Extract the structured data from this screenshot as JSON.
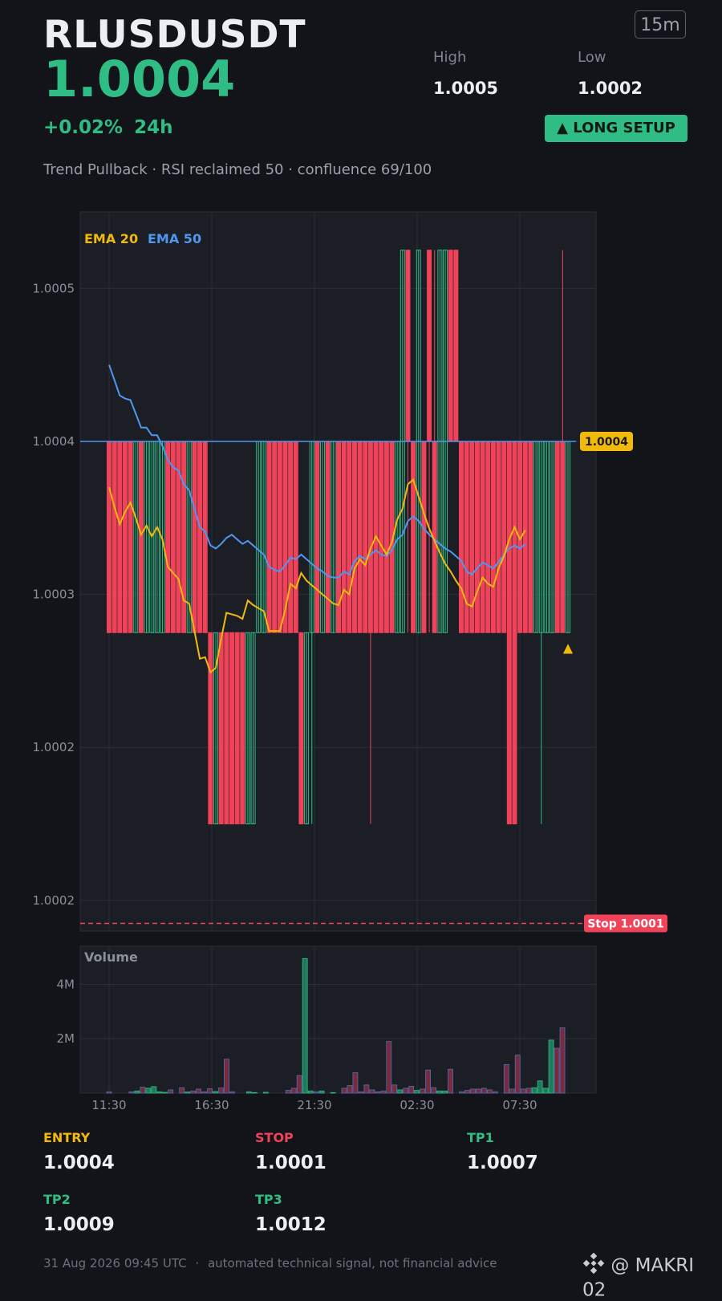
{
  "header": {
    "symbol": "RLUSDUSDT",
    "price": "1.0004",
    "change": "+0.02%",
    "period": "24h",
    "timeframe": "15m",
    "high_label": "High",
    "high_value": "1.0005",
    "low_label": "Low",
    "low_value": "1.0002",
    "setup_badge": "▲ LONG SETUP",
    "tagline": "Trend Pullback · RSI reclaimed 50 · confluence 69/100"
  },
  "colors": {
    "up": "#2fbd85",
    "down": "#f0435a",
    "ema20": "#f2b90d",
    "ema50": "#4f97f0",
    "background": "#131419",
    "panel": "#1c1e25"
  },
  "chart_data": {
    "type": "candlestick",
    "legend": [
      "EMA 20",
      "EMA 50"
    ],
    "price_ticks": [
      "1.0005",
      "1.0004",
      "1.0003",
      "1.0002",
      "1.0002"
    ],
    "ylim": [
      1.00008,
      1.00055
    ],
    "x_ticks": [
      "11:30",
      "16:30",
      "21:30",
      "02:30",
      "07:30"
    ],
    "current_price_label": "1.0004",
    "stop_line_label": "Stop 1.0001",
    "stop_price": 1.000085,
    "volume_title": "Volume",
    "volume_ticks": [
      "4M",
      "2M"
    ],
    "candles": [
      [
        1.0004,
        1.0004,
        1.000275,
        1.000275
      ],
      [
        1.0004,
        1.0004,
        1.000275,
        1.000275
      ],
      [
        1.0004,
        1.0004,
        1.000275,
        1.000275
      ],
      [
        1.0004,
        1.0004,
        1.000275,
        1.000275
      ],
      [
        1.0004,
        1.0004,
        1.000275,
        1.000275
      ],
      [
        1.000275,
        1.0004,
        1.000275,
        1.0004
      ],
      [
        1.0004,
        1.0004,
        1.000275,
        1.000275
      ],
      [
        1.000275,
        1.0004,
        1.000275,
        1.0004
      ],
      [
        1.000275,
        1.0004,
        1.000275,
        1.0004
      ],
      [
        1.000275,
        1.0004,
        1.000275,
        1.0004
      ],
      [
        1.000275,
        1.0004,
        1.000275,
        1.0004
      ],
      [
        1.0004,
        1.0004,
        1.000275,
        1.000275
      ],
      [
        1.0004,
        1.0004,
        1.000275,
        1.000275
      ],
      [
        1.0004,
        1.0004,
        1.000275,
        1.000275
      ],
      [
        1.0004,
        1.0004,
        1.000275,
        1.000275
      ],
      [
        1.000275,
        1.0004,
        1.000275,
        1.0004
      ],
      [
        1.0004,
        1.0004,
        1.000275,
        1.000275
      ],
      [
        1.0004,
        1.0004,
        1.000275,
        1.000275
      ],
      [
        1.0004,
        1.0004,
        1.000275,
        1.000275
      ],
      [
        1.000275,
        1.000275,
        1.00015,
        1.00015
      ],
      [
        1.00015,
        1.000275,
        1.00015,
        1.000275
      ],
      [
        1.000275,
        1.000275,
        1.00015,
        1.00015
      ],
      [
        1.000275,
        1.000275,
        1.00015,
        1.00015
      ],
      [
        1.000275,
        1.000275,
        1.00015,
        1.00015
      ],
      [
        1.000275,
        1.000275,
        1.00015,
        1.00015
      ],
      [
        1.000275,
        1.000275,
        1.00015,
        1.00015
      ],
      [
        1.00015,
        1.000275,
        1.00015,
        1.000275
      ],
      [
        1.00015,
        1.000275,
        1.00015,
        1.000275
      ],
      [
        1.000275,
        1.0004,
        1.000275,
        1.0004
      ],
      [
        1.000275,
        1.0004,
        1.000275,
        1.0004
      ],
      [
        1.0004,
        1.0004,
        1.000275,
        1.000275
      ],
      [
        1.0004,
        1.0004,
        1.000275,
        1.000275
      ],
      [
        1.0004,
        1.0004,
        1.000275,
        1.000275
      ],
      [
        1.0004,
        1.0004,
        1.000275,
        1.000275
      ],
      [
        1.0004,
        1.0004,
        1.000275,
        1.000275
      ],
      [
        1.0004,
        1.0004,
        1.000275,
        1.000275
      ],
      [
        1.000275,
        1.000275,
        1.00015,
        1.00015
      ],
      [
        1.00015,
        1.000275,
        1.00015,
        1.000275
      ],
      [
        1.000275,
        1.0004,
        1.00015,
        1.0004
      ],
      [
        1.0004,
        1.0004,
        1.000275,
        1.000275
      ],
      [
        1.000275,
        1.0004,
        1.000275,
        1.0004
      ],
      [
        1.0004,
        1.0004,
        1.000275,
        1.000275
      ],
      [
        1.000275,
        1.0004,
        1.000275,
        1.0004
      ],
      [
        1.0004,
        1.0004,
        1.000275,
        1.000275
      ],
      [
        1.0004,
        1.0004,
        1.000275,
        1.000275
      ],
      [
        1.0004,
        1.0004,
        1.000275,
        1.000275
      ],
      [
        1.0004,
        1.0004,
        1.000275,
        1.000275
      ],
      [
        1.0004,
        1.0004,
        1.000275,
        1.000275
      ],
      [
        1.0004,
        1.0004,
        1.000275,
        1.000275
      ],
      [
        1.0004,
        1.0004,
        1.00015,
        1.000275
      ],
      [
        1.0004,
        1.0004,
        1.000275,
        1.000275
      ],
      [
        1.0004,
        1.0004,
        1.000275,
        1.000275
      ],
      [
        1.0004,
        1.0004,
        1.000275,
        1.000275
      ],
      [
        1.0004,
        1.0004,
        1.000275,
        1.000275
      ],
      [
        1.000275,
        1.0004,
        1.000275,
        1.0004
      ],
      [
        1.000275,
        1.000525,
        1.000275,
        1.000525
      ],
      [
        1.000525,
        1.000525,
        1.000275,
        1.0004
      ],
      [
        1.0004,
        1.0004,
        1.000275,
        1.000275
      ],
      [
        1.000275,
        1.000525,
        1.000275,
        1.000525
      ],
      [
        1.0004,
        1.0004,
        1.000275,
        1.000275
      ],
      [
        1.000525,
        1.000525,
        1.000275,
        1.0004
      ],
      [
        1.0004,
        1.000525,
        1.000275,
        1.000275
      ],
      [
        1.000275,
        1.000525,
        1.000275,
        1.000525
      ],
      [
        1.000275,
        1.000525,
        1.000275,
        1.000525
      ],
      [
        1.000525,
        1.000525,
        1.0004,
        1.0004
      ],
      [
        1.000525,
        1.000525,
        1.0004,
        1.0004
      ],
      [
        1.0004,
        1.0004,
        1.000275,
        1.000275
      ],
      [
        1.0004,
        1.0004,
        1.000275,
        1.000275
      ],
      [
        1.0004,
        1.0004,
        1.000275,
        1.000275
      ],
      [
        1.0004,
        1.0004,
        1.000275,
        1.000275
      ],
      [
        1.0004,
        1.0004,
        1.000275,
        1.000275
      ],
      [
        1.0004,
        1.0004,
        1.000275,
        1.000275
      ],
      [
        1.0004,
        1.0004,
        1.000275,
        1.000275
      ],
      [
        1.0004,
        1.0004,
        1.000275,
        1.000275
      ],
      [
        1.0004,
        1.0004,
        1.000275,
        1.000275
      ],
      [
        1.0004,
        1.0004,
        1.00015,
        1.00015
      ],
      [
        1.0004,
        1.0004,
        1.00015,
        1.00015
      ],
      [
        1.0004,
        1.0004,
        1.000275,
        1.000275
      ],
      [
        1.0004,
        1.0004,
        1.000275,
        1.000275
      ],
      [
        1.0004,
        1.0004,
        1.000275,
        1.000275
      ],
      [
        1.000275,
        1.0004,
        1.000275,
        1.0004
      ],
      [
        1.000275,
        1.0004,
        1.00015,
        1.0004
      ],
      [
        1.000275,
        1.0004,
        1.000275,
        1.0004
      ],
      [
        1.000275,
        1.0004,
        1.000275,
        1.0004
      ],
      [
        1.0004,
        1.0004,
        1.000275,
        1.000275
      ],
      [
        1.0004,
        1.000525,
        1.000275,
        1.000275
      ],
      [
        1.000275,
        1.0004,
        1.000275,
        1.0004
      ]
    ],
    "ema20": [
      1.00037,
      1.000357,
      1.000346,
      1.000354,
      1.00036,
      1.00035,
      1.000339,
      1.000345,
      1.000338,
      1.000344,
      1.000336,
      1.000318,
      1.000314,
      1.00031,
      1.000296,
      1.000294,
      1.000276,
      1.000258,
      1.000259,
      1.000249,
      1.000252,
      1.000271,
      1.000288,
      1.000287,
      1.000286,
      1.000284,
      1.000296,
      1.000293,
      1.000291,
      1.000289,
      1.000276,
      1.000276,
      1.000276,
      1.00029,
      1.000307,
      1.000304,
      1.000314,
      1.000309,
      1.000306,
      1.000303,
      1.0003,
      1.000297,
      1.000294,
      1.000293,
      1.000303,
      1.0003,
      1.000317,
      1.000323,
      1.000319,
      1.00033,
      1.000338,
      1.000332,
      1.000326,
      1.000334,
      1.000349,
      1.000356,
      1.000372,
      1.000375,
      1.000364,
      1.000353,
      1.000343,
      1.000335,
      1.000327,
      1.00032,
      1.000315,
      1.000309,
      1.000304,
      1.000294,
      1.000292,
      1.000302,
      1.000311,
      1.000307,
      1.000305,
      1.000317,
      1.000325,
      1.000336,
      1.000344,
      1.000336,
      1.000342
    ],
    "ema50": [
      1.00045,
      1.00044,
      1.00043,
      1.000428,
      1.000427,
      1.000418,
      1.000409,
      1.000409,
      1.000404,
      1.000404,
      1.000397,
      1.000388,
      1.000383,
      1.000381,
      1.000372,
      1.000368,
      1.000356,
      1.000344,
      1.000341,
      1.000332,
      1.00033,
      1.000333,
      1.000337,
      1.000339,
      1.000336,
      1.000333,
      1.000335,
      1.000332,
      1.000329,
      1.000326,
      1.000318,
      1.000316,
      1.000315,
      1.000319,
      1.000324,
      1.000323,
      1.000326,
      1.000323,
      1.00032,
      1.000317,
      1.000315,
      1.000312,
      1.000311,
      1.000311,
      1.000315,
      1.000313,
      1.000322,
      1.000325,
      1.000323,
      1.000326,
      1.000329,
      1.000326,
      1.000325,
      1.000329,
      1.000336,
      1.000339,
      1.000348,
      1.000351,
      1.000348,
      1.000343,
      1.000339,
      1.000336,
      1.000333,
      1.00033,
      1.000328,
      1.000325,
      1.000322,
      1.000315,
      1.000313,
      1.000317,
      1.000321,
      1.000319,
      1.000317,
      1.000321,
      1.000326,
      1.00033,
      1.000332,
      1.00033,
      1.000333
    ],
    "volume": [
      0.05,
      0,
      0,
      0,
      0.05,
      0.08,
      0.22,
      0.18,
      0.24,
      0.05,
      0.03,
      0.12,
      0,
      0.2,
      0.04,
      0.08,
      0.15,
      0.05,
      0.16,
      0.06,
      0.19,
      1.25,
      0.05,
      0,
      0,
      0.05,
      0.02,
      0,
      0.03,
      0,
      0,
      0,
      0.1,
      0.18,
      0.65,
      4.95,
      0.08,
      0.05,
      0.08,
      0,
      0.02,
      0,
      0.18,
      0.28,
      0.75,
      0.05,
      0.3,
      0.12,
      0.05,
      0.08,
      1.9,
      0.3,
      0.12,
      0.18,
      0.25,
      0.1,
      0.15,
      0.85,
      0.2,
      0.08,
      0.08,
      0.88,
      0,
      0.05,
      0.1,
      0.15,
      0.15,
      0.18,
      0.12,
      0.05,
      0,
      1.05,
      0.15,
      1.4,
      0.15,
      0.18,
      0.2,
      0.45,
      0.18,
      1.95,
      1.65,
      2.4,
      0
    ]
  },
  "levels": [
    {
      "label": "ENTRY",
      "value": "1.0004",
      "color": "#f2b90d"
    },
    {
      "label": "STOP",
      "value": "1.0001",
      "color": "#f0435a"
    },
    {
      "label": "TP1",
      "value": "1.0007",
      "color": "#2fbd85"
    },
    {
      "label": "TP2",
      "value": "1.0009",
      "color": "#2fbd85"
    },
    {
      "label": "TP3",
      "value": "1.0012",
      "color": "#2fbd85"
    }
  ],
  "footer": {
    "timestamp": "31 Aug 2026 09:45 UTC",
    "separator": "·",
    "disclaimer": "automated technical signal, not financial advice",
    "brand_icon": "binance-logo-icon",
    "brand": "@ MAKRI 02"
  }
}
